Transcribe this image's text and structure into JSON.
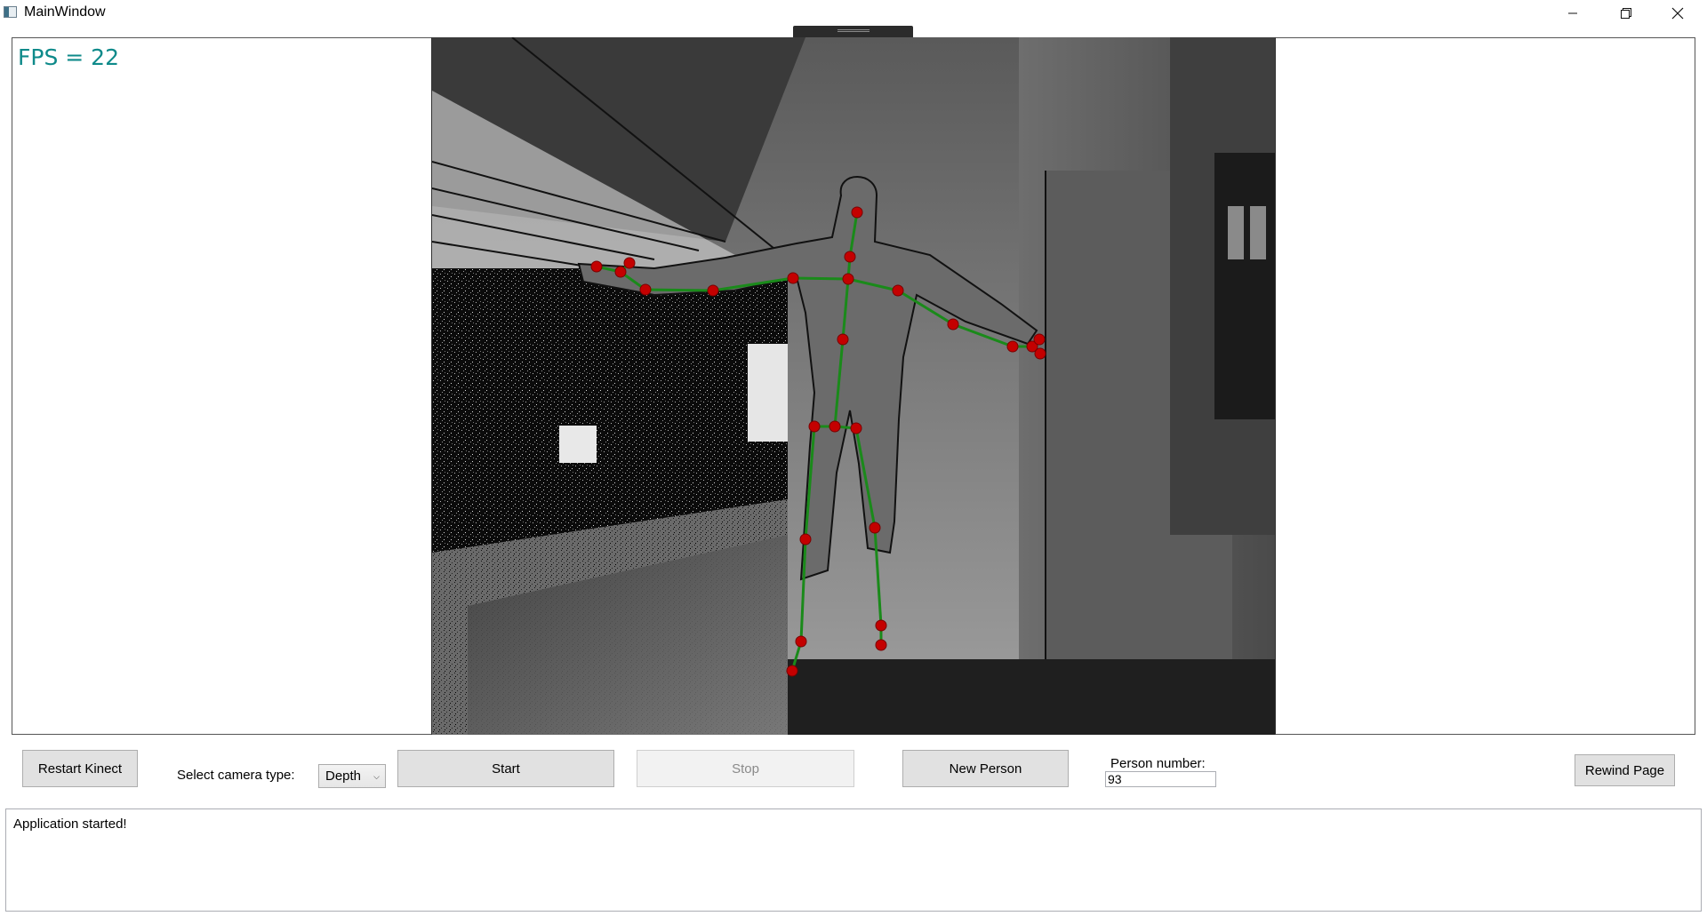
{
  "window": {
    "title": "MainWindow"
  },
  "view": {
    "fps_label": "FPS = 22",
    "camera_feed": "depth-image",
    "skeleton_colors": {
      "joint": "#c40000",
      "bone": "#1a8a1a"
    }
  },
  "toolbar": {
    "restart_label": "Restart Kinect",
    "camera_type_label": "Select camera type:",
    "camera_type_value": "Depth",
    "start_label": "Start",
    "stop_label": "Stop",
    "new_person_label": "New Person",
    "person_number_label": "Person number:",
    "person_number_value": "93",
    "rewind_label": "Rewind Page"
  },
  "log": {
    "text": "Application started!"
  }
}
